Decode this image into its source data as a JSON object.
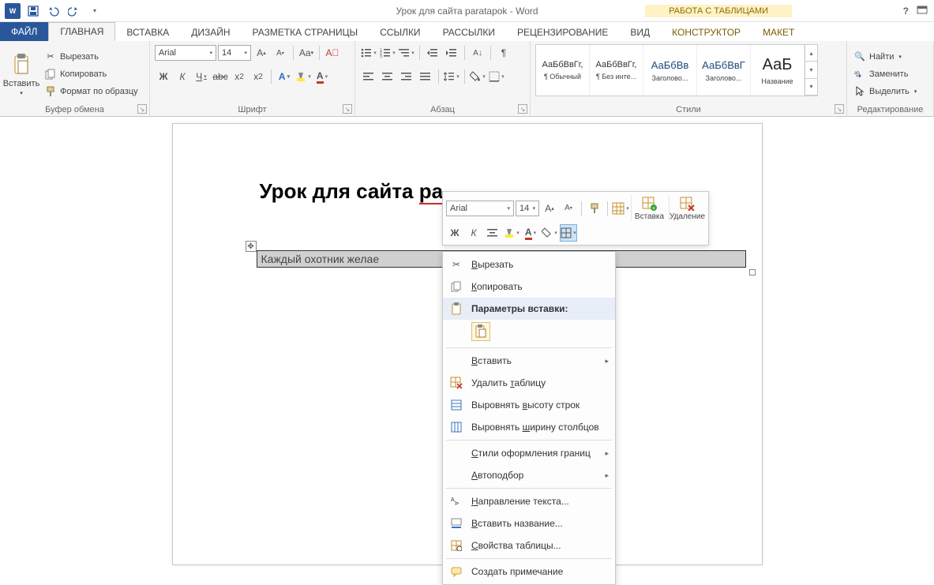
{
  "title": "Урок для сайта paratapok - Word",
  "table_tools_label": "РАБОТА С ТАБЛИЦАМИ",
  "tabs": {
    "file": "ФАЙЛ",
    "home": "ГЛАВНАЯ",
    "insert": "ВСТАВКА",
    "design": "ДИЗАЙН",
    "layout": "РАЗМЕТКА СТРАНИЦЫ",
    "references": "ССЫЛКИ",
    "mailings": "РАССЫЛКИ",
    "review": "РЕЦЕНЗИРОВАНИЕ",
    "view": "ВИД",
    "constructor": "КОНСТРУКТОР",
    "table_layout": "МАКЕТ"
  },
  "clipboard": {
    "paste": "Вставить",
    "cut": "Вырезать",
    "copy": "Копировать",
    "format_painter": "Формат по образцу",
    "group": "Буфер обмена"
  },
  "font": {
    "name": "Arial",
    "size": "14",
    "group": "Шрифт"
  },
  "paragraph": {
    "group": "Абзац"
  },
  "styles": {
    "group": "Стили",
    "items": [
      {
        "preview": "АаБбВвГг,",
        "label": "¶ Обычный"
      },
      {
        "preview": "АаБбВвГг,",
        "label": "¶ Без инте..."
      },
      {
        "preview": "АаБбВв",
        "label": "Заголово..."
      },
      {
        "preview": "АаБбВвГ",
        "label": "Заголово..."
      },
      {
        "preview": "АаБ",
        "label": "Название"
      }
    ]
  },
  "editing": {
    "find": "Найти",
    "replace": "Заменить",
    "select": "Выделить",
    "group": "Редактирование"
  },
  "document": {
    "heading": "Урок для сайта pa",
    "table_cell": "Каждый охотник желае"
  },
  "mini": {
    "font": "Arial",
    "size": "14",
    "insert": "Вставка",
    "delete": "Удаление"
  },
  "context": {
    "cut": "Вырезать",
    "copy": "Копировать",
    "paste_options": "Параметры вставки:",
    "insert": "Вставить",
    "delete_table": "Удалить таблицу",
    "distribute_rows": "Выровнять высоту строк",
    "distribute_cols": "Выровнять ширину столбцов",
    "border_styles": "Стили оформления границ",
    "autofit": "Автоподбор",
    "text_direction": "Направление текста...",
    "insert_caption": "Вставить название...",
    "table_properties": "Свойства таблицы...",
    "new_comment": "Создать примечание"
  }
}
